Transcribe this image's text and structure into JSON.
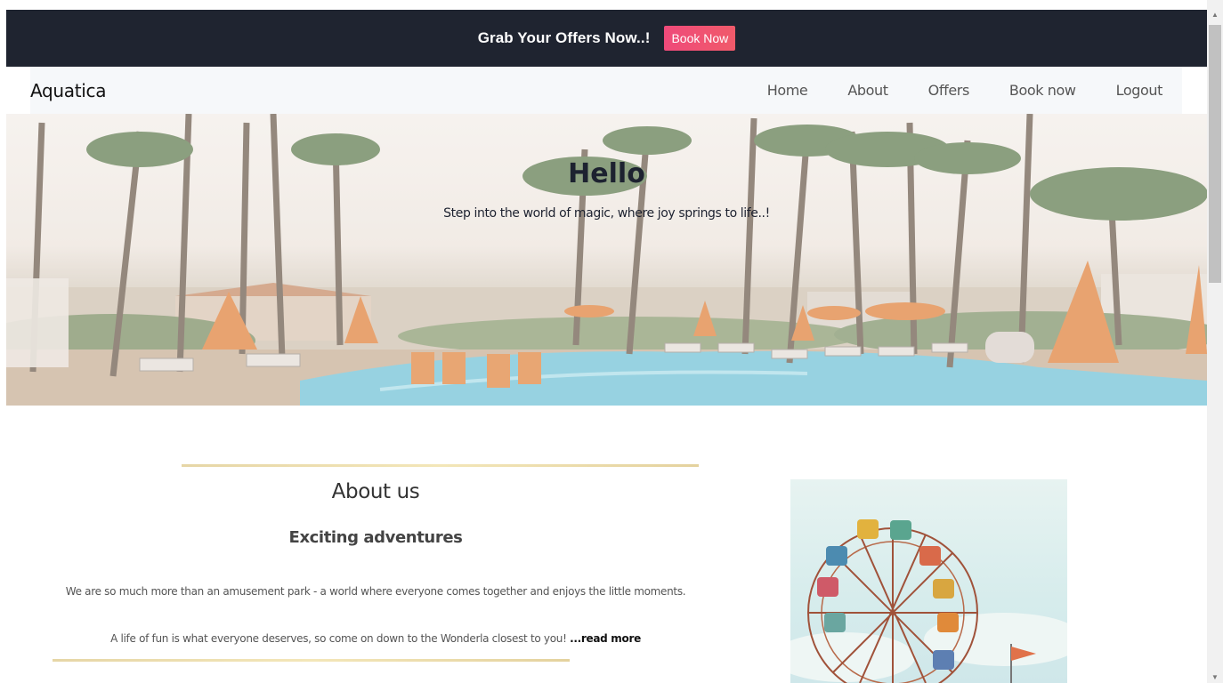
{
  "offer_bar": {
    "text": "Grab Your Offers Now..!",
    "button_label": "Book Now",
    "bg_color": "#1f2430",
    "button_color": "#ef4a7a"
  },
  "navbar": {
    "brand": "Aquatica",
    "links": [
      {
        "label": "Home"
      },
      {
        "label": "About"
      },
      {
        "label": "Offers"
      },
      {
        "label": "Book now"
      },
      {
        "label": "Logout"
      }
    ]
  },
  "hero": {
    "title": "Hello",
    "subtitle": "Step into the world of magic, where joy springs to life..!"
  },
  "about": {
    "title": "About us",
    "subtitle": "Exciting adventures",
    "paragraph1": "We are so much more than an amusement park - a world where everyone comes together and enjoys the little moments.",
    "paragraph2": "A life of fun is what everyone deserves, so come on down to the Wonderla closest to you!",
    "read_more": "...read more"
  }
}
